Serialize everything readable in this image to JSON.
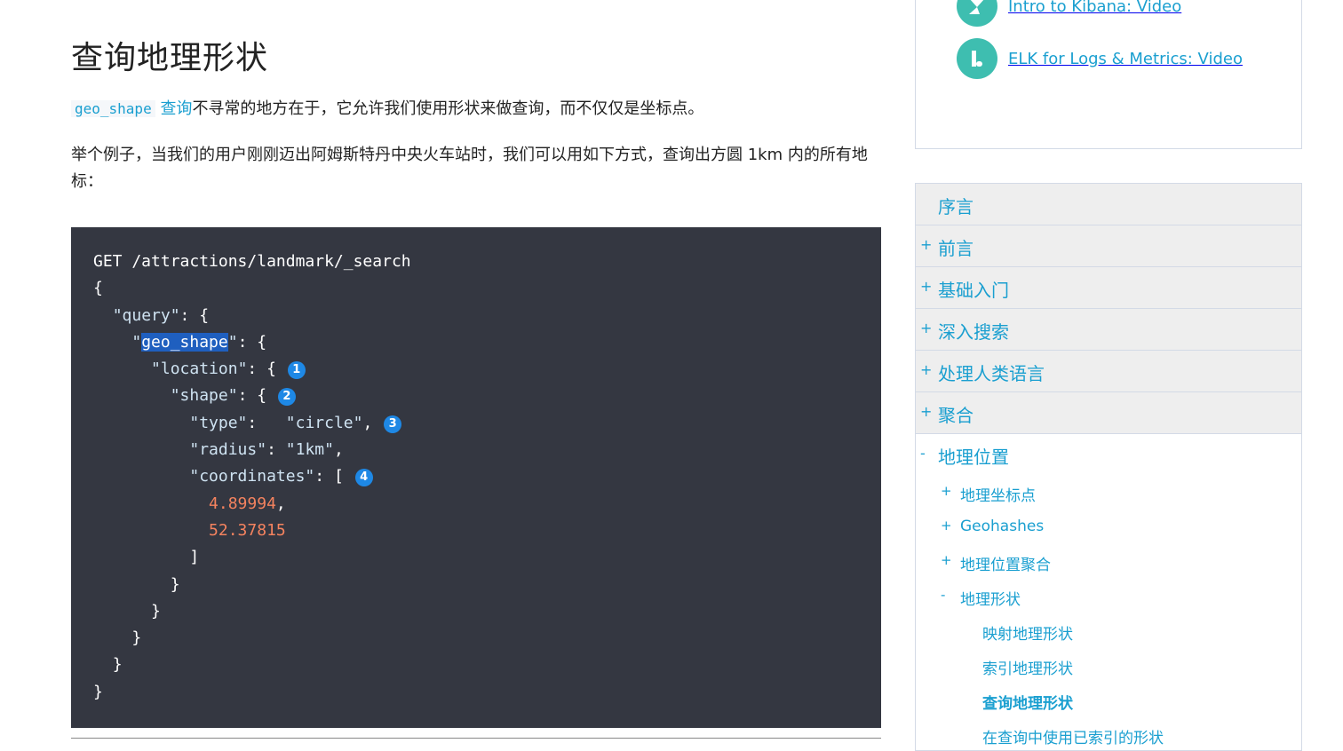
{
  "page": {
    "title": "查询地理形状",
    "intro": {
      "code": "geo_shape",
      "link": "查询",
      "rest": "不寻常的地方在于，它允许我们使用形状来做查询，而不仅仅是坐标点。"
    },
    "example": "举个例子，当我们的用户刚刚迈出阿姆斯特丹中央火车站时，我们可以用如下方式，查询出方圆 1km 内的所有地标："
  },
  "code": {
    "request": "GET /attractions/landmark/_search",
    "open_brace": "{",
    "query_key": "\"query\"",
    "geo_shape_q1": "\"",
    "geo_shape_key": "geo_shape",
    "geo_shape_q2": "\"",
    "location_key": "\"location\"",
    "shape_key": "\"shape\"",
    "type_key": "\"type\"",
    "type_value": "\"circle\"",
    "radius_key": "\"radius\"",
    "radius_value": "\"1km\"",
    "coordinates_key": "\"coordinates\"",
    "lon": "4.89994",
    "lat": "52.37815",
    "close_bracket": "]",
    "close_brace": "}",
    "callouts": [
      "1",
      "2",
      "3",
      "4"
    ]
  },
  "sidebar": {
    "videos": [
      {
        "label": "Intro to Kibana: Video",
        "icon": "kibana-logo-icon"
      },
      {
        "label": "ELK for Logs & Metrics: Video",
        "icon": "elk-logo-icon"
      }
    ],
    "toc": {
      "top": [
        {
          "label": "序言",
          "sign": ""
        },
        {
          "label": "前言",
          "sign": "+"
        },
        {
          "label": "基础入门",
          "sign": "+"
        },
        {
          "label": "深入搜索",
          "sign": "+"
        },
        {
          "label": "处理人类语言",
          "sign": "+"
        },
        {
          "label": "聚合",
          "sign": "+"
        }
      ],
      "open": {
        "label": "地理位置",
        "sign": "-"
      },
      "sub": [
        {
          "label": "地理坐标点",
          "sign": "+"
        },
        {
          "label": "Geohashes",
          "sign": "+"
        },
        {
          "label": "地理位置聚合",
          "sign": "+"
        },
        {
          "label": "地理形状",
          "sign": "-"
        }
      ],
      "subsub": [
        {
          "label": "映射地理形状"
        },
        {
          "label": "索引地理形状"
        },
        {
          "label": "查询地理形状"
        },
        {
          "label": "在查询中使用已索引的形状"
        }
      ]
    }
  },
  "colors": {
    "link": "#1a9fd0",
    "code_bg": "#343741",
    "number": "#f5835f",
    "callout": "#1e88e5",
    "video_icon": "#3ebeb0"
  }
}
